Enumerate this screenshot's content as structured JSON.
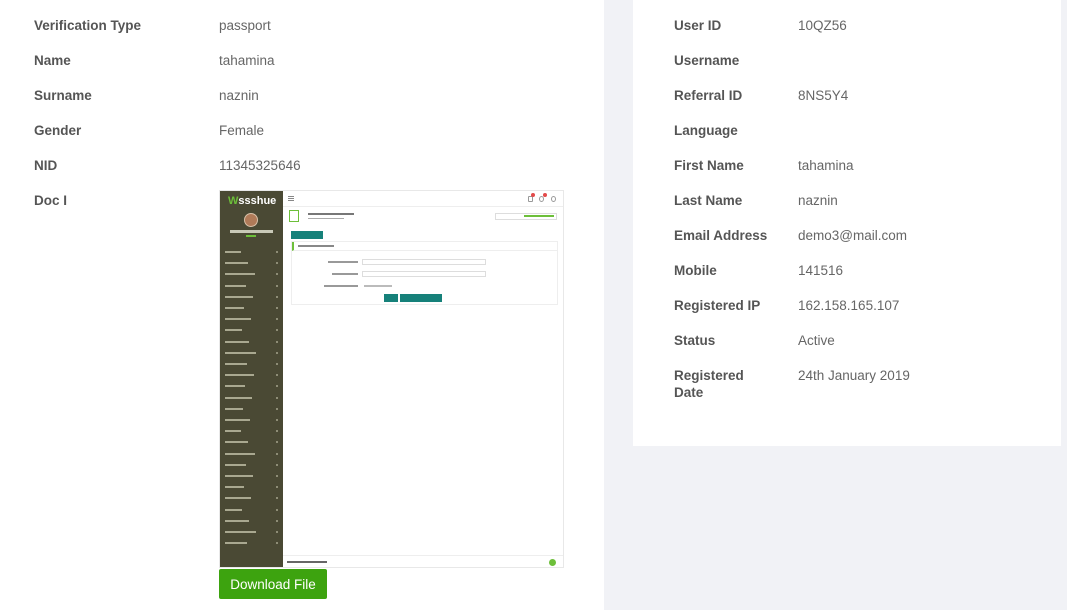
{
  "left_panel": {
    "rows": [
      {
        "label": "Verification Type",
        "value": "passport"
      },
      {
        "label": "Name",
        "value": "tahamina"
      },
      {
        "label": "Surname",
        "value": "naznin"
      },
      {
        "label": "Gender",
        "value": "Female"
      },
      {
        "label": "NID",
        "value": "11345325646"
      },
      {
        "label": "Doc I",
        "value": ""
      }
    ],
    "document_image": {
      "logo_prefix": "W",
      "logo_text": "ssshue",
      "icon": "document-screenshot"
    },
    "download_button": "Download File"
  },
  "right_panel": {
    "rows": [
      {
        "label": "User ID",
        "value": "10QZ56"
      },
      {
        "label": "Username",
        "value": ""
      },
      {
        "label": "Referral ID",
        "value": "8NS5Y4"
      },
      {
        "label": "Language",
        "value": ""
      },
      {
        "label": "First Name",
        "value": "tahamina"
      },
      {
        "label": "Last Name",
        "value": "naznin"
      },
      {
        "label": "Email Address",
        "value": "demo3@mail.com"
      },
      {
        "label": "Mobile",
        "value": "141516"
      },
      {
        "label": "Registered IP",
        "value": "162.158.165.107"
      },
      {
        "label": "Status",
        "value": "Active"
      },
      {
        "label": "Registered Date",
        "value": "24th January 2019"
      }
    ]
  },
  "colors": {
    "page_bg": "#f1f2f6",
    "card_bg": "#ffffff",
    "label": "#555555",
    "value": "#666666",
    "download_button": "#3da30f",
    "doc_sidebar": "#4a4934",
    "doc_accent": "#16817a"
  }
}
